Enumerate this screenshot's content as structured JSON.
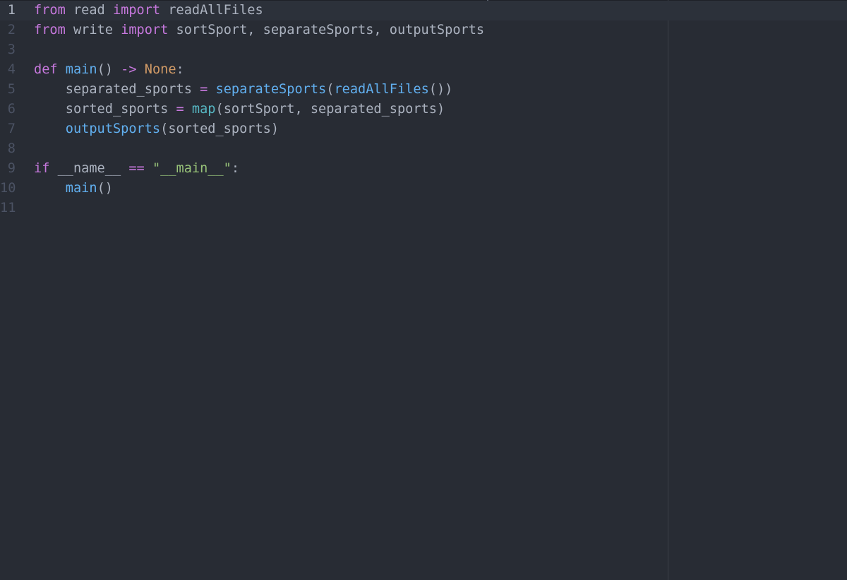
{
  "editor": {
    "language": "python",
    "active_line": 1,
    "colors": {
      "background": "#282c34",
      "keyword": "#c678dd",
      "function": "#61afef",
      "builtin": "#56b6c2",
      "constant": "#d19a66",
      "string": "#98c379",
      "plain": "#abb2bf",
      "gutter": "#4b5263"
    },
    "lines": [
      {
        "number": "1",
        "tokens": [
          {
            "t": "from",
            "c": "keyword"
          },
          {
            "t": " read ",
            "c": "plain"
          },
          {
            "t": "import",
            "c": "keyword"
          },
          {
            "t": " readAllFiles",
            "c": "plain"
          }
        ]
      },
      {
        "number": "2",
        "tokens": [
          {
            "t": "from",
            "c": "keyword"
          },
          {
            "t": " write ",
            "c": "plain"
          },
          {
            "t": "import",
            "c": "keyword"
          },
          {
            "t": " sortSport, separateSports, outputSports",
            "c": "plain"
          }
        ]
      },
      {
        "number": "3",
        "tokens": []
      },
      {
        "number": "4",
        "tokens": [
          {
            "t": "def",
            "c": "keyword"
          },
          {
            "t": " ",
            "c": "plain"
          },
          {
            "t": "main",
            "c": "function"
          },
          {
            "t": "() ",
            "c": "plain"
          },
          {
            "t": "->",
            "c": "keyword"
          },
          {
            "t": " ",
            "c": "plain"
          },
          {
            "t": "None",
            "c": "constant"
          },
          {
            "t": ":",
            "c": "plain"
          }
        ]
      },
      {
        "number": "5",
        "tokens": [
          {
            "t": "    separated_sports ",
            "c": "plain"
          },
          {
            "t": "=",
            "c": "keyword"
          },
          {
            "t": " ",
            "c": "plain"
          },
          {
            "t": "separateSports",
            "c": "function"
          },
          {
            "t": "(",
            "c": "plain"
          },
          {
            "t": "readAllFiles",
            "c": "function"
          },
          {
            "t": "())",
            "c": "plain"
          }
        ]
      },
      {
        "number": "6",
        "tokens": [
          {
            "t": "    sorted_sports ",
            "c": "plain"
          },
          {
            "t": "=",
            "c": "keyword"
          },
          {
            "t": " ",
            "c": "plain"
          },
          {
            "t": "map",
            "c": "builtin"
          },
          {
            "t": "(sortSport, separated_sports)",
            "c": "plain"
          }
        ]
      },
      {
        "number": "7",
        "tokens": [
          {
            "t": "    ",
            "c": "plain"
          },
          {
            "t": "outputSports",
            "c": "function"
          },
          {
            "t": "(sorted_sports)",
            "c": "plain"
          }
        ]
      },
      {
        "number": "8",
        "tokens": []
      },
      {
        "number": "9",
        "tokens": [
          {
            "t": "if",
            "c": "keyword"
          },
          {
            "t": " __name__ ",
            "c": "plain"
          },
          {
            "t": "==",
            "c": "keyword"
          },
          {
            "t": " ",
            "c": "plain"
          },
          {
            "t": "\"__main__\"",
            "c": "string"
          },
          {
            "t": ":",
            "c": "plain"
          }
        ]
      },
      {
        "number": "10",
        "tokens": [
          {
            "t": "    ",
            "c": "plain"
          },
          {
            "t": "main",
            "c": "function"
          },
          {
            "t": "()",
            "c": "plain"
          }
        ]
      },
      {
        "number": "11",
        "tokens": []
      }
    ]
  }
}
